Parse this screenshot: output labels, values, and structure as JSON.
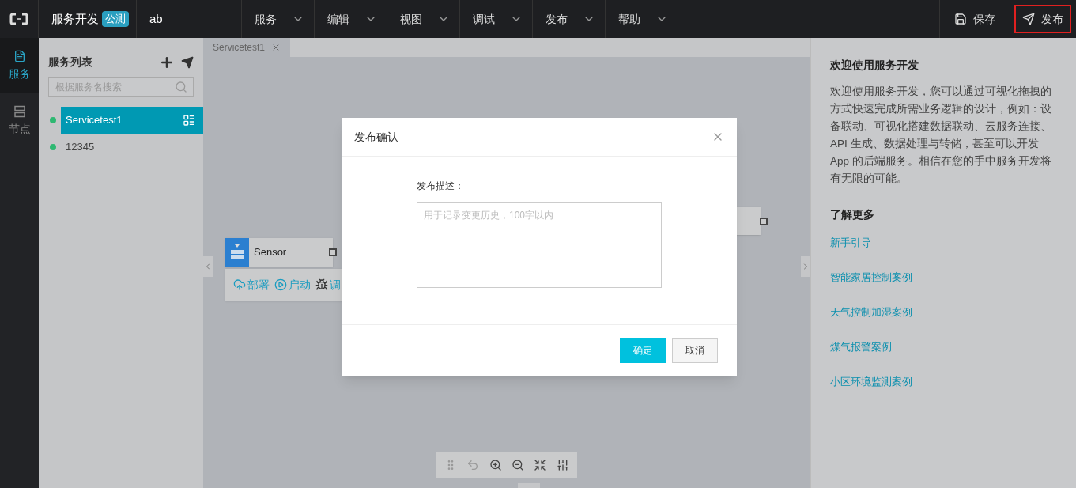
{
  "app": {
    "title": "服务开发",
    "badge": "公测",
    "project": "ab"
  },
  "menu": [
    {
      "label": "服务"
    },
    {
      "label": "编辑"
    },
    {
      "label": "视图"
    },
    {
      "label": "调试"
    },
    {
      "label": "发布"
    },
    {
      "label": "帮助"
    }
  ],
  "actions": [
    {
      "label": "保存",
      "kind": "save",
      "highlighted": false
    },
    {
      "label": "发布",
      "kind": "publish",
      "highlighted": true
    }
  ],
  "rail": [
    {
      "label": "服务",
      "kind": "doc",
      "selected": true
    },
    {
      "label": "节点",
      "kind": "node",
      "selected": false
    }
  ],
  "sidebar": {
    "title": "服务列表",
    "search": {
      "placeholder": "根据服务名搜索"
    },
    "items": [
      {
        "label": "Servicetest1",
        "selected": true
      },
      {
        "label": "12345",
        "selected": false
      }
    ]
  },
  "editor": {
    "tabs": [
      {
        "label": "Servicetest1",
        "selected": true
      }
    ],
    "node": {
      "label": "Sensor",
      "actions": [
        {
          "label": "部署",
          "kind": "upload"
        },
        {
          "label": "启动",
          "kind": "play"
        },
        {
          "label": "调",
          "kind": "bug"
        }
      ]
    }
  },
  "dialog": {
    "title": "发布确认",
    "field_label": "发布描述：",
    "placeholder": "用于记录变更历史，100字以内",
    "buttons": [
      {
        "label": "确定",
        "kind": "primary"
      },
      {
        "label": "取消",
        "kind": "default"
      }
    ]
  },
  "help": {
    "title": "欢迎使用服务开发",
    "intro": "欢迎使用服务开发，您可以通过可视化拖拽的方式快速完成所需业务逻辑的设计，例如：设备联动、可视化搭建数据联动、云服务连接、API 生成、数据处理与转储，甚至可以开发 App 的后端服务。相信在您的手中服务开发将有无限的可能。",
    "more_title": "了解更多",
    "links": [
      "新手引导",
      "智能家居控制案例",
      "天气控制加湿案例",
      "煤气报警案例",
      "小区环境监测案例"
    ]
  }
}
